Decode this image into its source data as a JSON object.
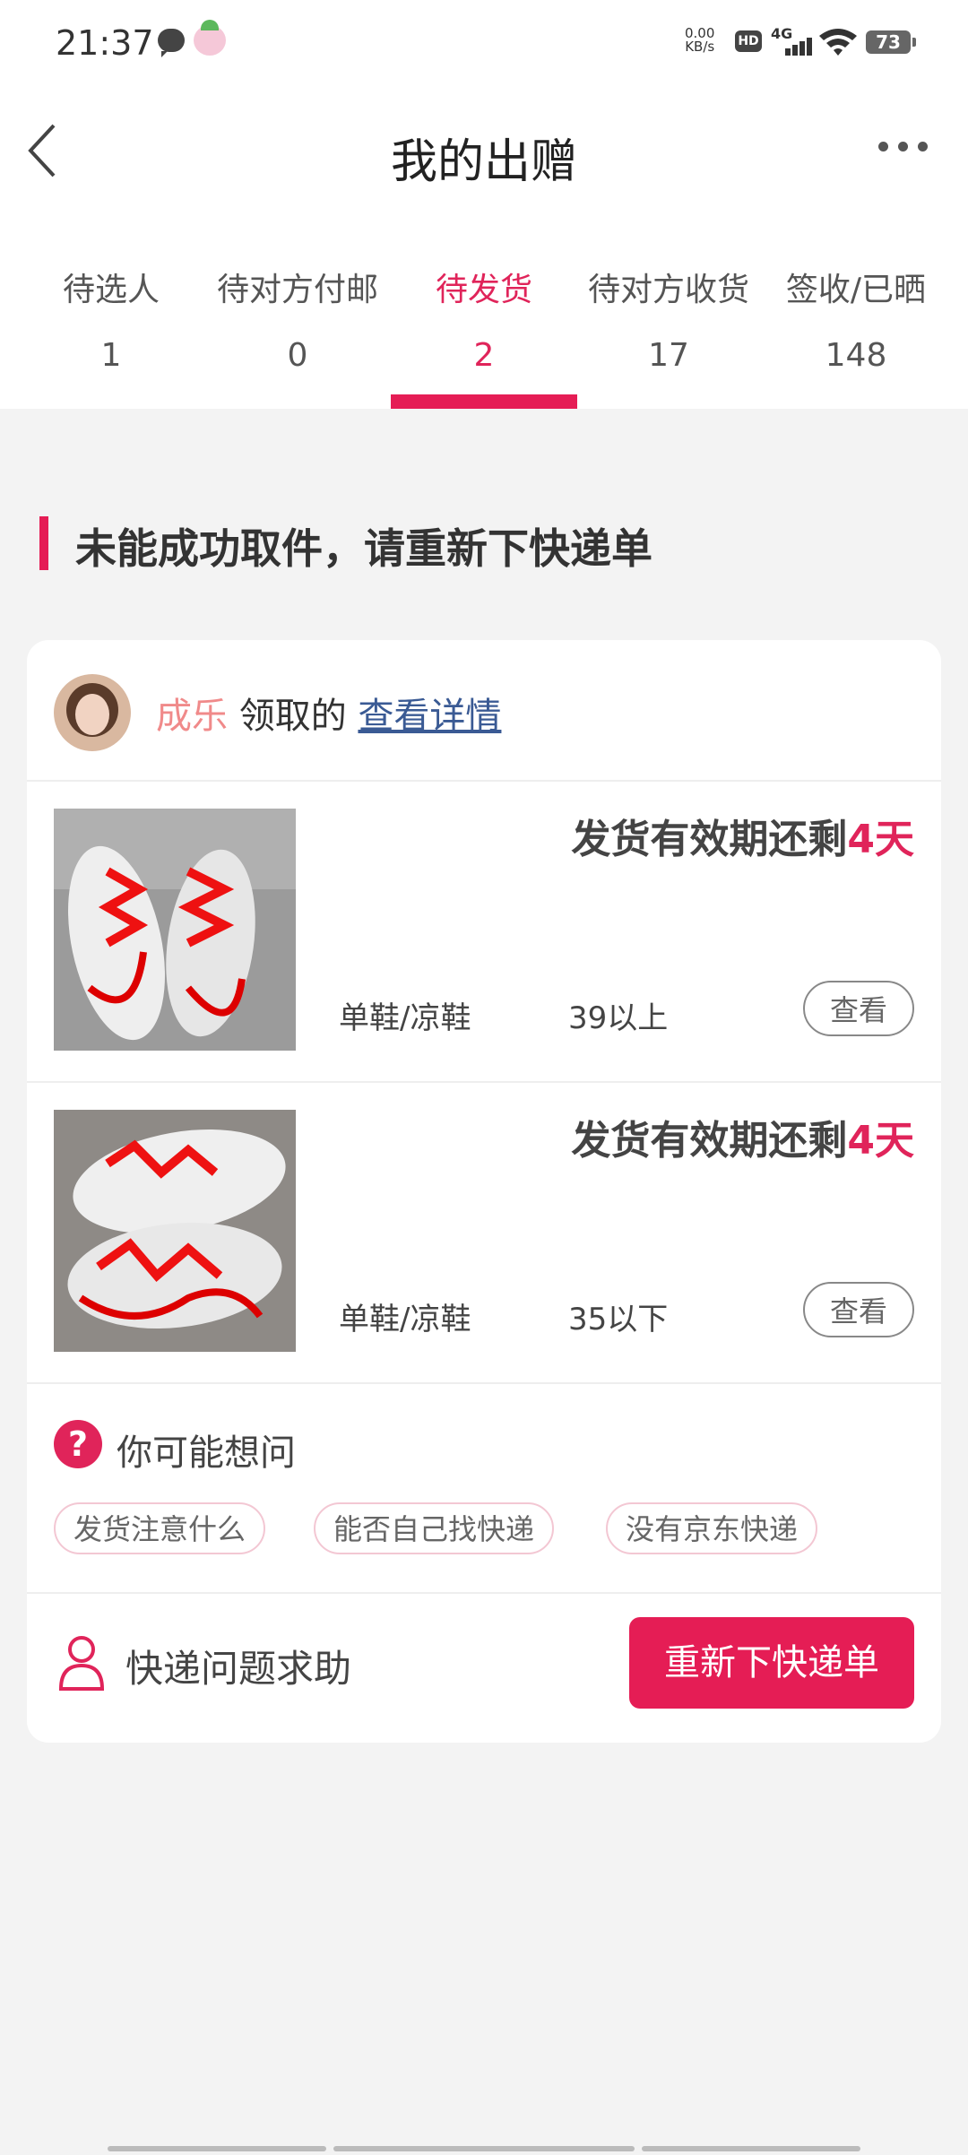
{
  "status_bar": {
    "time": "21:37",
    "speed_value": "0.00",
    "speed_unit": "KB/s",
    "hd": "HD",
    "network": "4G",
    "battery": "73"
  },
  "nav": {
    "back_icon": "chevron-left-icon",
    "title": "我的出赠",
    "more_icon": "more-icon"
  },
  "tabs": [
    {
      "label": "待选人",
      "count": "1",
      "active": false
    },
    {
      "label": "待对方付邮",
      "count": "0",
      "active": false
    },
    {
      "label": "待发货",
      "count": "2",
      "active": true
    },
    {
      "label": "待对方收货",
      "count": "17",
      "active": false
    },
    {
      "label": "签收/已晒",
      "count": "148",
      "active": false
    }
  ],
  "notice": {
    "text": "未能成功取件，请重新下快递单"
  },
  "card": {
    "receiver": {
      "name": "成乐",
      "action": " 领取的 ",
      "link": "查看详情"
    },
    "items": [
      {
        "deadline_prefix": "发货有效期还剩",
        "deadline_value": "4天",
        "category": "单鞋/凉鞋",
        "size": "39以上",
        "button": "查看"
      },
      {
        "deadline_prefix": "发货有效期还剩",
        "deadline_value": "4天",
        "category": "单鞋/凉鞋",
        "size": "35以下",
        "button": "查看"
      }
    ],
    "faq": {
      "icon": "question-icon",
      "icon_glyph": "?",
      "title": "你可能想问",
      "chips": [
        "发货注意什么",
        "能否自己找快递",
        "没有京东快递"
      ]
    },
    "help": {
      "icon": "person-icon",
      "text": "快递问题求助",
      "button": "重新下快递单"
    }
  },
  "colors": {
    "accent": "#e51d55",
    "receiver_name": "#f08a8a",
    "link": "#3a5a94",
    "page_bg": "#f3f3f3"
  }
}
